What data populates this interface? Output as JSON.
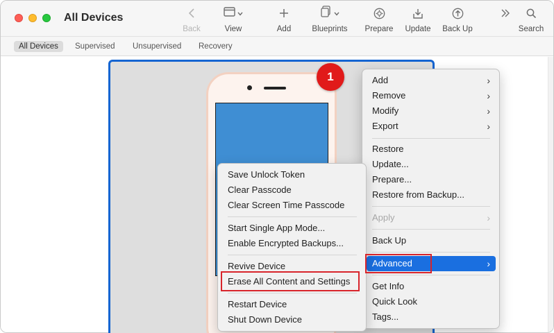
{
  "window": {
    "title": "All Devices"
  },
  "toolbar": {
    "back": {
      "label": "Back",
      "icon": "chevron-left-icon"
    },
    "view": {
      "label": "View",
      "icon": "window-icon"
    },
    "add": {
      "label": "Add",
      "icon": "plus-icon"
    },
    "blueprints": {
      "label": "Blueprints",
      "icon": "document-stack-icon"
    },
    "prepare": {
      "label": "Prepare",
      "icon": "gear-circle-icon"
    },
    "update": {
      "label": "Update",
      "icon": "download-tray-icon"
    },
    "backup": {
      "label": "Back Up",
      "icon": "arrow-up-circle-icon"
    },
    "more": {
      "icon": "double-chevron-right-icon"
    },
    "search": {
      "label": "Search",
      "icon": "search-icon"
    }
  },
  "filters": [
    "All Devices",
    "Supervised",
    "Unsupervised",
    "Recovery"
  ],
  "badge": "1",
  "context_menu": {
    "group1": [
      "Add",
      "Remove",
      "Modify",
      "Export"
    ],
    "group2": [
      "Restore",
      "Update...",
      "Prepare...",
      "Restore from Backup..."
    ],
    "apply": "Apply",
    "back_up": "Back Up",
    "advanced": "Advanced",
    "group5": [
      "Get Info",
      "Quick Look",
      "Tags..."
    ]
  },
  "submenu": {
    "group1": [
      "Save Unlock Token",
      "Clear Passcode",
      "Clear Screen Time Passcode"
    ],
    "group2": [
      "Start Single App Mode...",
      "Enable Encrypted Backups..."
    ],
    "group3": [
      "Revive Device",
      "Erase All Content and Settings"
    ],
    "group4": [
      "Restart Device",
      "Shut Down Device"
    ]
  },
  "colors": {
    "accent": "#1a6fe0",
    "selection_border": "#1565d2",
    "annotation_red": "#d8242b",
    "screen_blue": "#3f8ed3",
    "badge_red": "#e11a1a"
  }
}
